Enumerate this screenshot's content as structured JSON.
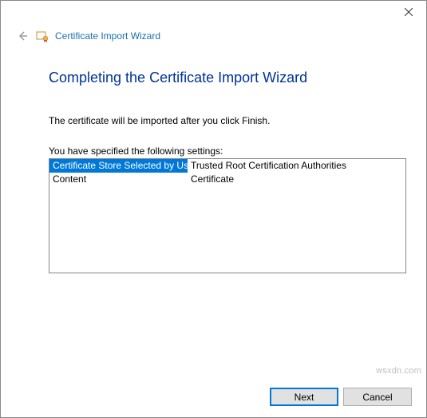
{
  "window": {
    "wizard_title": "Certificate Import Wizard"
  },
  "content": {
    "heading": "Completing the Certificate Import Wizard",
    "instruction": "The certificate will be imported after you click Finish.",
    "settings_label": "You have specified the following settings:",
    "rows": [
      {
        "key": "Certificate Store Selected by User",
        "value": "Trusted Root Certification Authorities",
        "selected": true
      },
      {
        "key": "Content",
        "value": "Certificate",
        "selected": false
      }
    ]
  },
  "buttons": {
    "next": "Next",
    "cancel": "Cancel"
  },
  "watermark": "wsxdn.com"
}
